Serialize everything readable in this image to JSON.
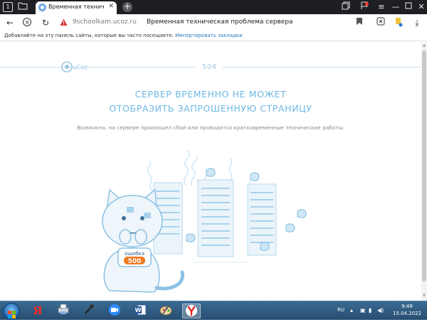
{
  "browser": {
    "tab": {
      "title": "Временная техническ",
      "close_icon": "close-icon"
    },
    "address": {
      "url": "9schoolkam.ucoz.ru",
      "page_title": "Временная техническая проблема сервера"
    },
    "bookmarks_bar": {
      "text": "Добавляйте на эту панель сайты, которые вы часто посещаете. ",
      "link": "Импортировать закладки"
    }
  },
  "page": {
    "logo_text": "uCoz",
    "code": "504",
    "title_line1": "СЕРВЕР ВРЕМЕННО НЕ МОЖЕТ",
    "title_line2": "ОТОБРАЗИТЬ ЗАПРОШЕННУЮ СТРАНИЦУ",
    "subtitle": "Возможно, на сервере произошел сбой или проводятся кратковременные технические работы.",
    "sign_top": "ошибка",
    "sign_bottom": "500"
  },
  "taskbar": {
    "apps": [
      "yandex-icon",
      "printer-icon",
      "microphone-icon",
      "zoom-icon",
      "word-icon",
      "paint-icon",
      "yandex-browser-icon"
    ],
    "language": "RU",
    "time": "9:48",
    "date": "15.04.2022"
  },
  "colors": {
    "accent": "#6db8e2",
    "taskbar": "#2f5f88",
    "tabbar": "#1e1f22"
  }
}
